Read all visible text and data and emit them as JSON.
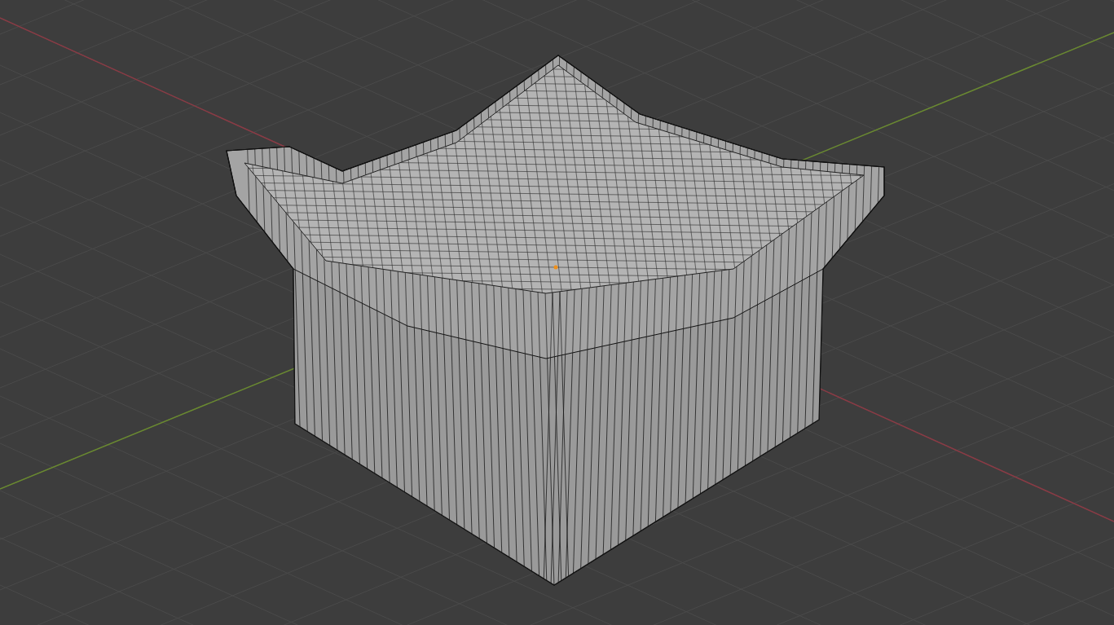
{
  "viewport": {
    "grid_visible": true,
    "axes_visible": true,
    "origin_visible": true
  }
}
